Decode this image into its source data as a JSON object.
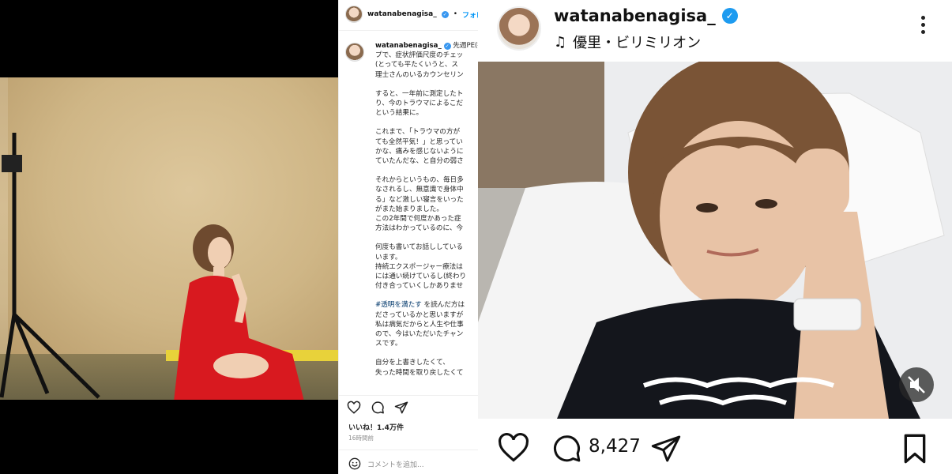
{
  "middle": {
    "username": "watanabenagisa_",
    "follow_label": "フォロ",
    "caption_username": "watanabenagisa_",
    "paragraphs": [
      "先週PE(持続エ\nプで、症状評価尺度のチェッ\n(とっても平たくいうと、ス\n理士さんのいるカウンセリン",
      "すると、一年前に測定したト\nり、今のトラウマによるこだ\nという結果に。",
      "これまで、「トラウマの方が\nても全然平気！」と思ってい\nかな、痛みを感じないように\nていたんだな、と自分の弱さ",
      "それからというもの、毎日多\nなされるし、無意識で身体中\nる」など激しい寝言をいった\nがまた始まりました。\nこの2年間で何度かあった症\n方法はわかっているのに、今",
      "何度も書いてお話ししている\nいます。\n持続エクスポージャー療法は\nには通い続けているし(終わり\n付き合っていくしかありませ"
    ],
    "hashtag": "#透明を満たす",
    "paragraph_after_hashtag": " を読んだ方は\nださっているかと思いますが\n私は病気だからと人生や仕事\nので、今はいただいたチャン\nスです。",
    "last_paragraph": "自分を上書きしたくて、\n失った時間を取り戻したくて",
    "likes": "いいね！1.4万件",
    "time": "16時間前",
    "comment_placeholder": "コメントを追加..."
  },
  "right": {
    "username": "watanabenagisa_",
    "music": "優里・ビリミリオン",
    "comment_count": "8,427"
  }
}
